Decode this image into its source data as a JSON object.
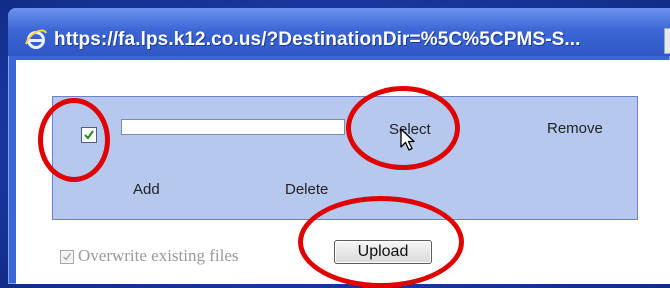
{
  "window": {
    "title": "https://fa.lps.k12.co.us/?DestinationDir=%5C%5CPMS-S...",
    "icon": "internet-explorer-icon"
  },
  "uploader": {
    "file_checked": true,
    "file_path_value": "",
    "select_label": "Select",
    "remove_label": "Remove",
    "add_label": "Add",
    "delete_label": "Delete",
    "overwrite_label": "Overwrite existing files",
    "overwrite_checked": true,
    "overwrite_disabled": true,
    "upload_label": "Upload"
  },
  "annotations": {
    "color": "#e00000",
    "targets": [
      "file-checkbox",
      "select-link",
      "upload-button"
    ]
  },
  "colors": {
    "frame": "#3a66d8",
    "panel": "#b6c8ee",
    "client": "#ffffff"
  }
}
